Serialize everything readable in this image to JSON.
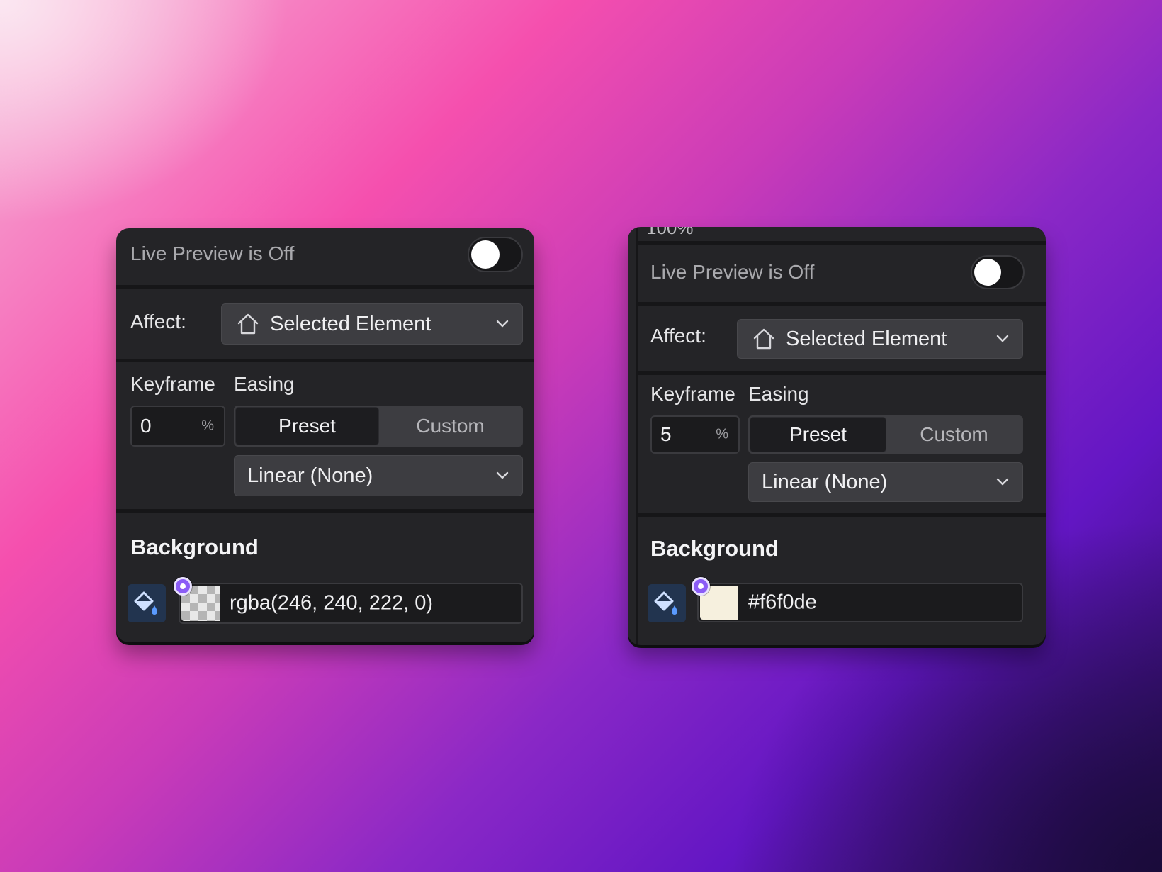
{
  "panels": [
    {
      "live_preview": {
        "label": "Live Preview is Off",
        "on": false
      },
      "affect": {
        "label": "Affect:",
        "value": "Selected Element",
        "icon": "home-icon"
      },
      "keyframe": {
        "label": "Keyframe",
        "value": "0",
        "unit": "%"
      },
      "easing": {
        "label": "Easing",
        "tabs": [
          "Preset",
          "Custom"
        ],
        "active_tab": "Preset",
        "preset_value": "Linear (None)"
      },
      "background": {
        "heading": "Background",
        "color_value": "rgba(246, 240, 222, 0)",
        "swatch_color": "transparent"
      }
    },
    {
      "zoom_peek": "100%",
      "live_preview": {
        "label": "Live Preview is Off",
        "on": false
      },
      "affect": {
        "label": "Affect:",
        "value": "Selected Element",
        "icon": "home-icon"
      },
      "keyframe": {
        "label": "Keyframe",
        "value": "5",
        "unit": "%"
      },
      "easing": {
        "label": "Easing",
        "tabs": [
          "Preset",
          "Custom"
        ],
        "active_tab": "Preset",
        "preset_value": "Linear (None)"
      },
      "background": {
        "heading": "Background",
        "color_value": "#f6f0de",
        "swatch_color": "#f6f0de"
      }
    }
  ],
  "colors": {
    "panel_bg": "#242427",
    "control_bg": "#3d3d41",
    "accent_dot": "#8b5cf6",
    "paint_button_bg": "#22344f"
  }
}
